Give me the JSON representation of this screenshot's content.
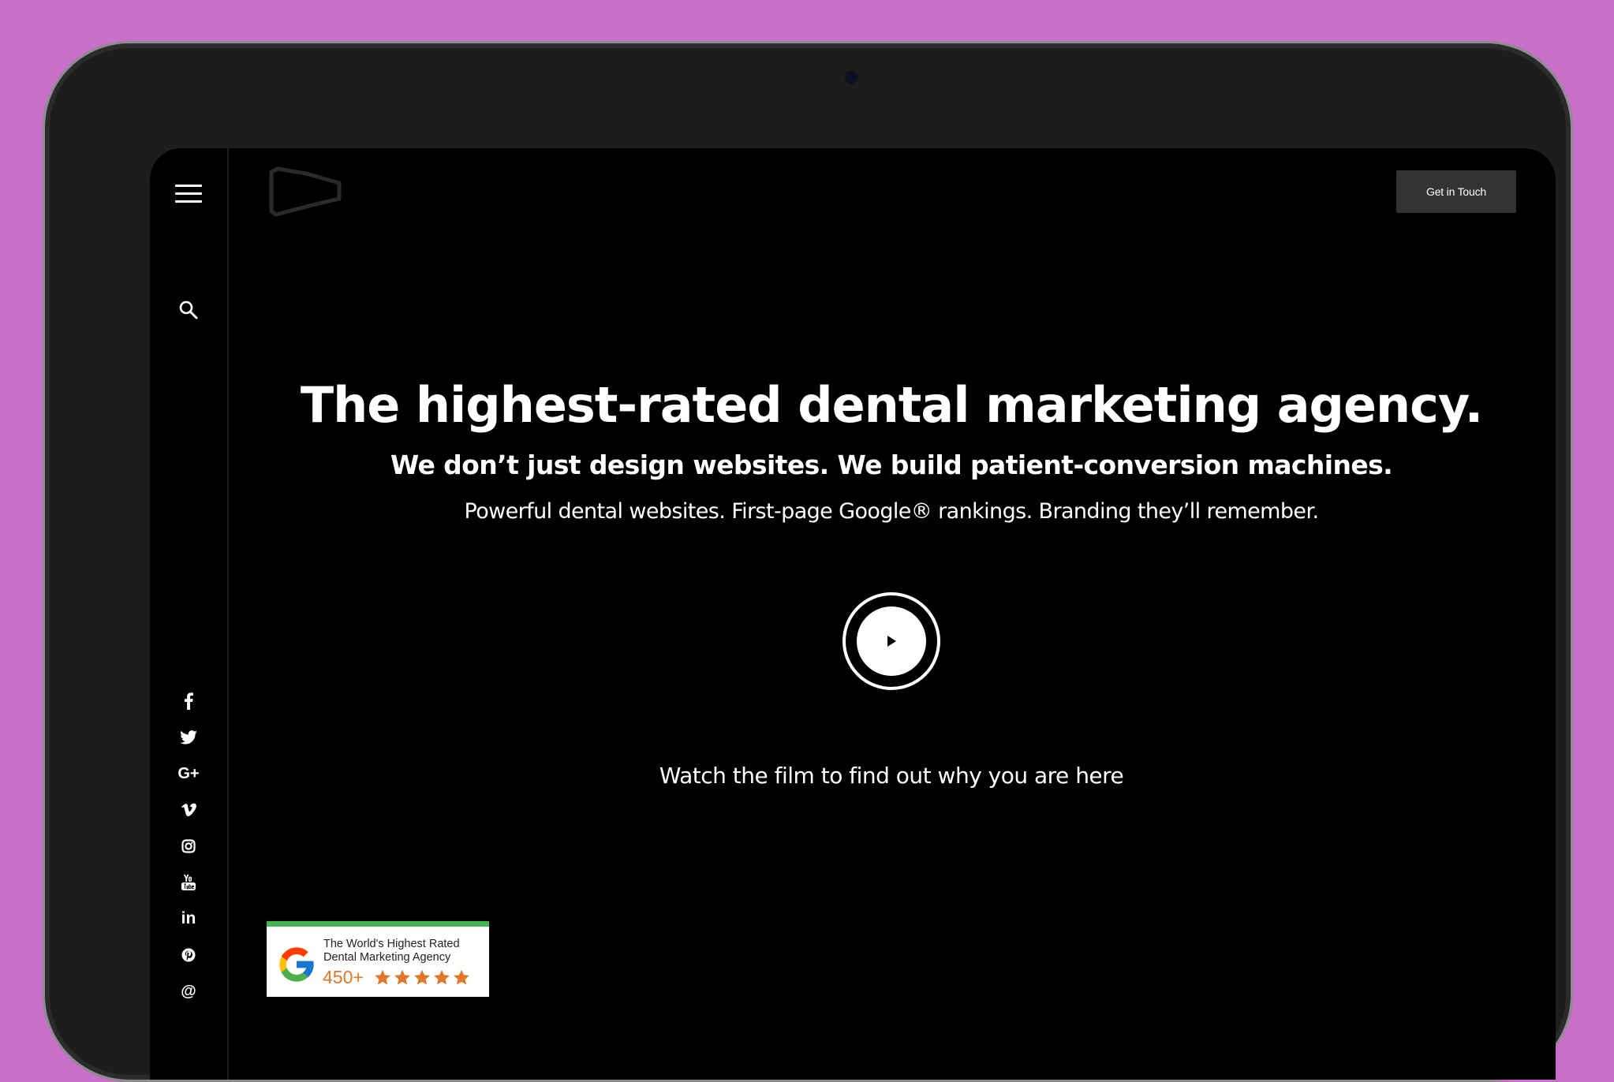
{
  "header": {
    "cta_label": "Get in Touch"
  },
  "hero": {
    "headline": "The highest-rated dental marketing agency.",
    "subheadline": "We don’t just design websites. We build patient-conversion machines.",
    "tagline": "Powerful dental websites. First-page Google® rankings. Branding they’ll remember.",
    "video_caption": "Watch the film to find out why you are here"
  },
  "sidebar": {
    "socials": [
      {
        "icon": "facebook-icon"
      },
      {
        "icon": "twitter-icon"
      },
      {
        "icon": "google-plus-icon",
        "glyph": "G+"
      },
      {
        "icon": "vimeo-icon"
      },
      {
        "icon": "instagram-icon"
      },
      {
        "icon": "youtube-icon"
      },
      {
        "icon": "linkedin-icon",
        "glyph": "in"
      },
      {
        "icon": "pinterest-icon"
      },
      {
        "icon": "email-icon",
        "glyph": "@"
      }
    ]
  },
  "badge": {
    "line1": "The World's Highest Rated",
    "line2": "Dental Marketing Agency",
    "count": "450+",
    "rating_stars": 5,
    "star_color": "#e0772a",
    "accent_color": "#44b554"
  },
  "colors": {
    "page_background": "#c86fc9",
    "screen_background": "#000000",
    "cta_background": "#333333"
  }
}
